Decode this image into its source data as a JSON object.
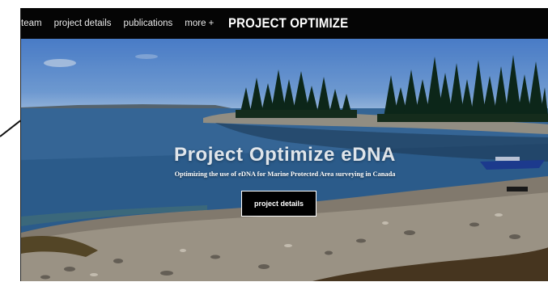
{
  "header": {
    "nav": [
      {
        "label": "team"
      },
      {
        "label": "project details"
      },
      {
        "label": "publications"
      },
      {
        "label": "more +"
      }
    ],
    "brand": "PROJECT OPTIMIZE"
  },
  "hero": {
    "title": "Project Optimize eDNA",
    "subtitle": "Optimizing the use of eDNA for Marine Protected Area surveying in Canada",
    "button_label": "project details"
  },
  "colors": {
    "header_bg": "#050505",
    "button_bg": "#000000",
    "sky": "#4f86d7",
    "water": "#2c5f93"
  }
}
